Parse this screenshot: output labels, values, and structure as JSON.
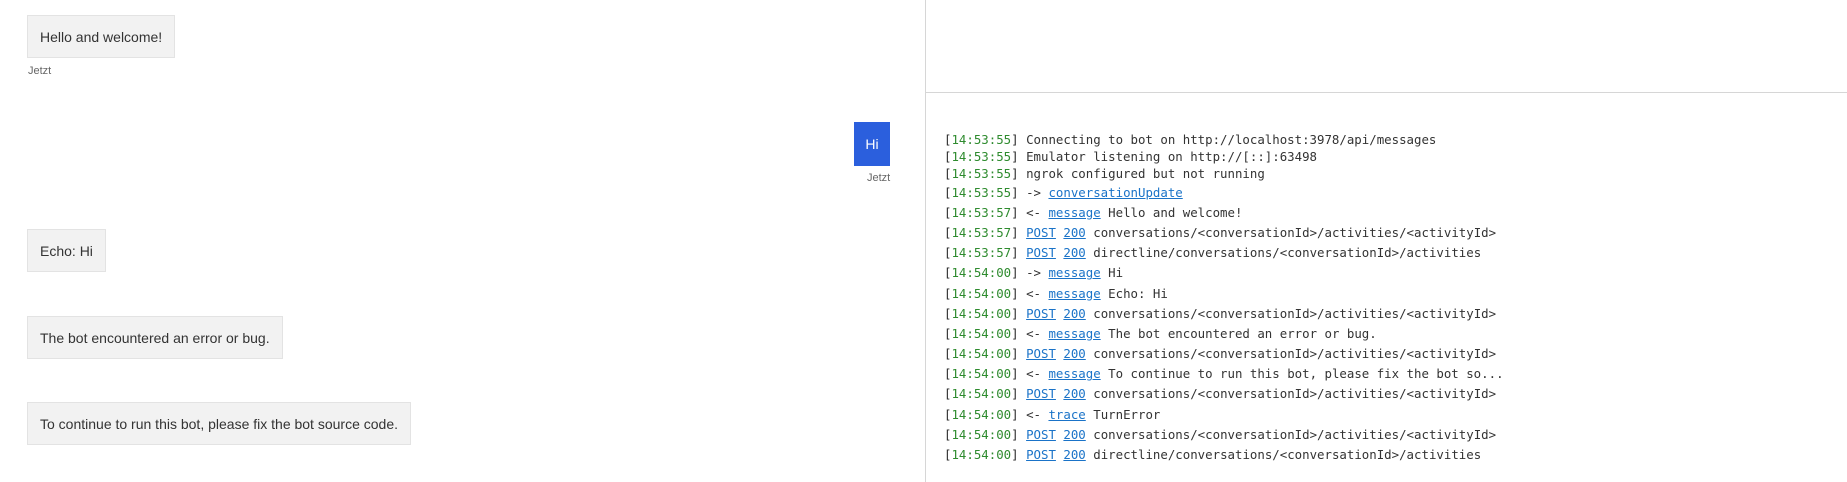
{
  "chat": {
    "messages": [
      {
        "from": "bot",
        "text": "Hello and welcome!",
        "timestamp": "Jetzt"
      },
      {
        "from": "user",
        "text": "Hi",
        "timestamp": "Jetzt"
      },
      {
        "from": "bot",
        "text": "Echo: Hi"
      },
      {
        "from": "bot",
        "text": "The bot encountered an error or bug."
      },
      {
        "from": "bot",
        "text": "To continue to run this bot, please fix the bot source code."
      }
    ]
  },
  "log": {
    "entries": [
      {
        "time": "14:53:55",
        "arrow": "",
        "link": "",
        "code": "",
        "text": "Connecting to bot on http://localhost:3978/api/messages"
      },
      {
        "time": "14:53:55",
        "arrow": "",
        "link": "",
        "code": "",
        "text": "Emulator listening on http://[::]:63498"
      },
      {
        "time": "14:53:55",
        "arrow": "",
        "link": "",
        "code": "",
        "text": "ngrok configured but not running"
      },
      {
        "time": "14:53:55",
        "arrow": "->",
        "link": "conversationUpdate",
        "code": "",
        "text": ""
      },
      {
        "time": "14:53:57",
        "arrow": "<-",
        "link": "message",
        "code": "",
        "text": "Hello and welcome!"
      },
      {
        "time": "14:53:57",
        "arrow": "",
        "link": "POST",
        "code": "200",
        "text": "conversations/<conversationId>/activities/<activityId>"
      },
      {
        "time": "14:53:57",
        "arrow": "",
        "link": "POST",
        "code": "200",
        "text": "directline/conversations/<conversationId>/activities"
      },
      {
        "time": "14:54:00",
        "arrow": "->",
        "link": "message",
        "code": "",
        "text": "Hi"
      },
      {
        "time": "14:54:00",
        "arrow": "<-",
        "link": "message",
        "code": "",
        "text": "Echo: Hi"
      },
      {
        "time": "14:54:00",
        "arrow": "",
        "link": "POST",
        "code": "200",
        "text": "conversations/<conversationId>/activities/<activityId>"
      },
      {
        "time": "14:54:00",
        "arrow": "<-",
        "link": "message",
        "code": "",
        "text": "The bot encountered an error or bug."
      },
      {
        "time": "14:54:00",
        "arrow": "",
        "link": "POST",
        "code": "200",
        "text": "conversations/<conversationId>/activities/<activityId>"
      },
      {
        "time": "14:54:00",
        "arrow": "<-",
        "link": "message",
        "code": "",
        "text": "To continue to run this bot, please fix the bot so..."
      },
      {
        "time": "14:54:00",
        "arrow": "",
        "link": "POST",
        "code": "200",
        "text": "conversations/<conversationId>/activities/<activityId>"
      },
      {
        "time": "14:54:00",
        "arrow": "<-",
        "link": "trace",
        "code": "",
        "text": "TurnError"
      },
      {
        "time": "14:54:00",
        "arrow": "",
        "link": "POST",
        "code": "200",
        "text": "conversations/<conversationId>/activities/<activityId>"
      },
      {
        "time": "14:54:00",
        "arrow": "",
        "link": "POST",
        "code": "200",
        "text": "directline/conversations/<conversationId>/activities"
      }
    ]
  }
}
